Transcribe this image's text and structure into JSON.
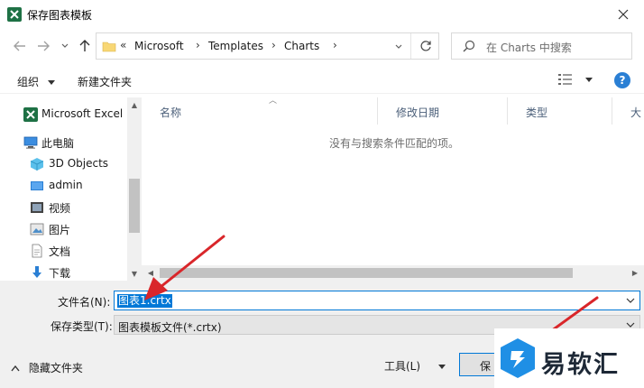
{
  "window": {
    "title": "保存图表模板"
  },
  "address": {
    "prefix": "«",
    "crumbs": [
      "Microsoft",
      "Templates",
      "Charts"
    ]
  },
  "search": {
    "placeholder": "在 Charts 中搜索"
  },
  "toolbar": {
    "organize": "组织",
    "new_folder": "新建文件夹",
    "help": "?"
  },
  "nav": {
    "items": [
      {
        "label": "Microsoft Excel",
        "icon": "excel-icon"
      },
      {
        "label": "此电脑",
        "icon": "computer-icon"
      },
      {
        "label": "3D Objects",
        "icon": "3d-objects-icon"
      },
      {
        "label": "admin",
        "icon": "folder-icon"
      },
      {
        "label": "视频",
        "icon": "video-icon"
      },
      {
        "label": "图片",
        "icon": "pictures-icon"
      },
      {
        "label": "文档",
        "icon": "document-icon"
      },
      {
        "label": "下载",
        "icon": "download-icon"
      }
    ]
  },
  "filelist": {
    "columns": [
      "名称",
      "修改日期",
      "类型",
      "大"
    ],
    "empty_message": "没有与搜索条件匹配的项。"
  },
  "form": {
    "filename_label": "文件名(N):",
    "filename_value": "图表1.crtx",
    "filetype_label": "保存类型(T):",
    "filetype_value": "图表模板文件(*.crtx)"
  },
  "footer": {
    "hide_folders": "隐藏文件夹",
    "tools": "工具(L)",
    "save": "保"
  },
  "watermark": {
    "text": "易软汇"
  },
  "colors": {
    "accent": "#0078d7",
    "arrow": "#d9262a"
  }
}
